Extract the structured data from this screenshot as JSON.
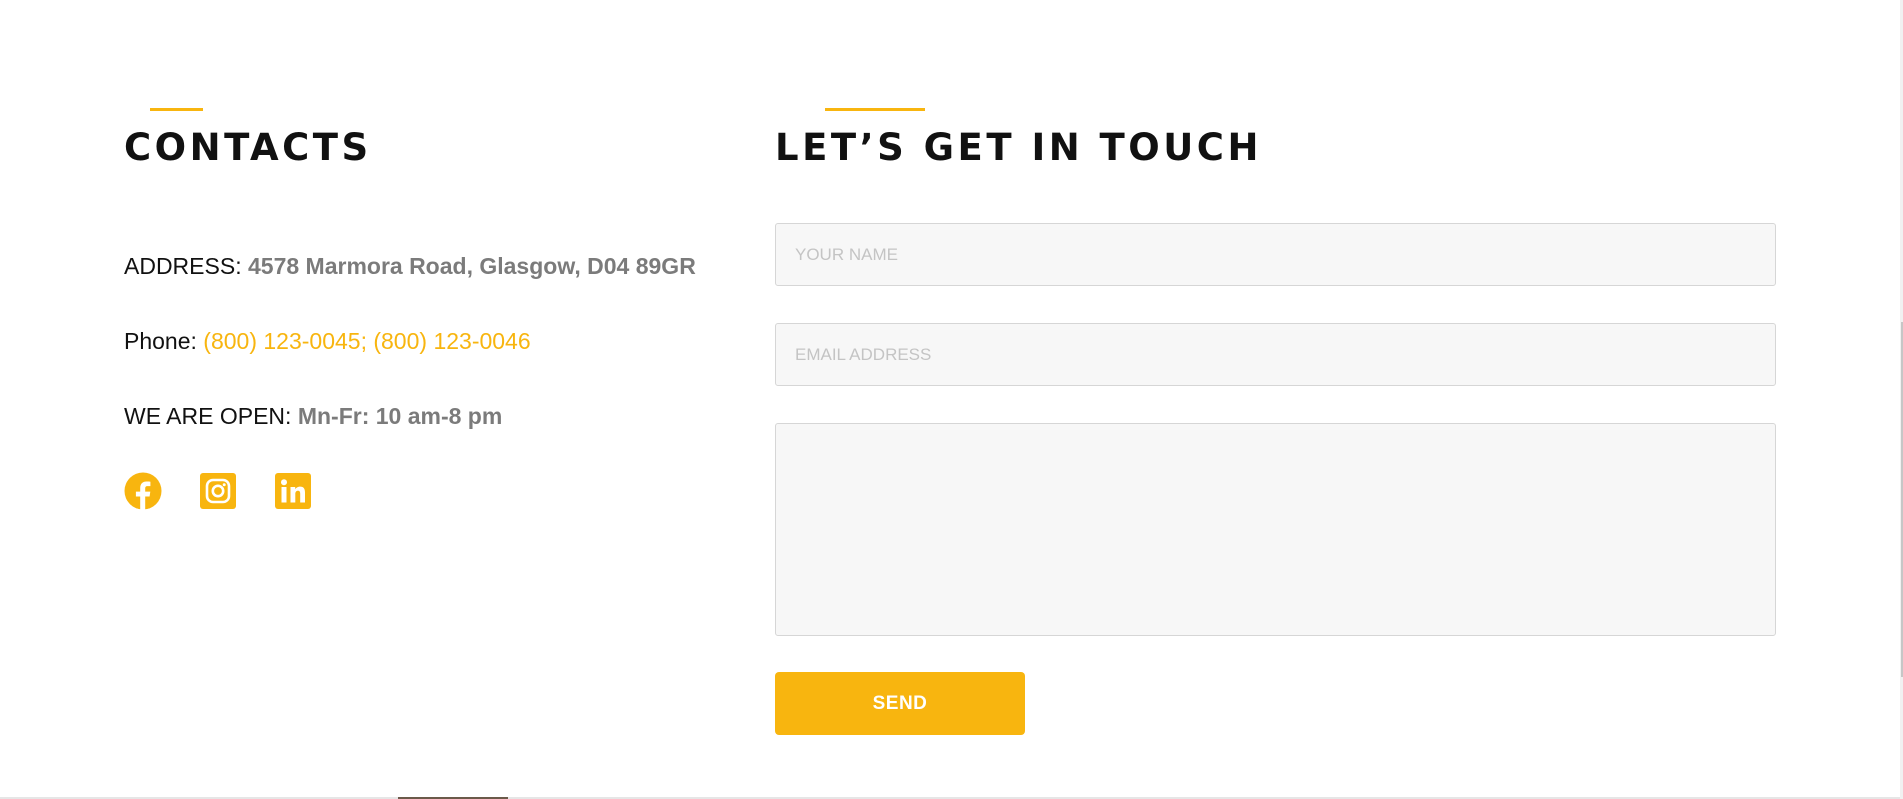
{
  "colors": {
    "accent": "#f8b50f",
    "heading": "#111111",
    "muted_text": "#7b7b7b",
    "field_background": "#f7f7f7",
    "field_border": "#d6d6d6",
    "button_text": "#ffffff"
  },
  "contacts": {
    "title": "CONTACTS",
    "address": {
      "label": "ADDRESS:",
      "value": "4578 Marmora Road, Glasgow, D04 89GR"
    },
    "phone": {
      "label": "Phone:",
      "value": "(800) 123-0045; (800) 123-0046"
    },
    "hours": {
      "label": "WE ARE OPEN:",
      "value": "Mn-Fr: 10 am-8 pm"
    },
    "socials": [
      {
        "icon": "facebook-icon"
      },
      {
        "icon": "instagram-icon"
      },
      {
        "icon": "linkedin-icon"
      }
    ]
  },
  "touch": {
    "title": "LET’S GET IN TOUCH",
    "form": {
      "name_placeholder": "YOUR NAME",
      "email_placeholder": "EMAIL ADDRESS",
      "message_placeholder": "",
      "send_label": "SEND"
    }
  }
}
